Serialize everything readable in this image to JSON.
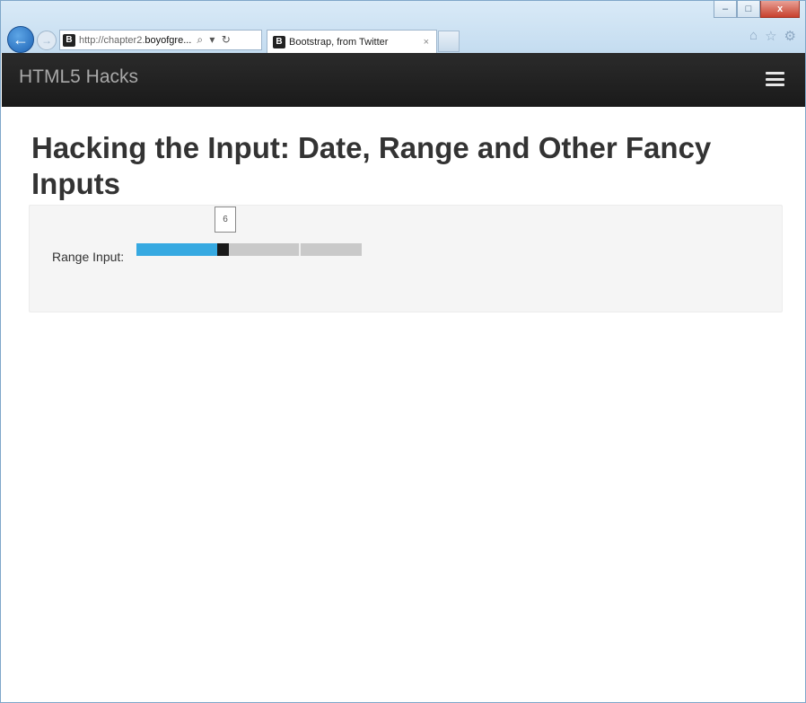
{
  "browser": {
    "address_prefix": "http://chapter2.",
    "address_host": "boyofgre...",
    "address_controls": "⌕ ▾ ↻",
    "favicon_letter": "B",
    "tab_title": "Bootstrap, from Twitter",
    "tab_close": "×",
    "window_controls": {
      "minimize": "–",
      "maximize": "□",
      "close": "x"
    },
    "icons": [
      "home-icon",
      "star-icon",
      "gear-icon"
    ]
  },
  "navbar": {
    "brand": "HTML5 Hacks",
    "menu_icon": "hamburger-menu-icon"
  },
  "page": {
    "title": "Hacking the Input: Date, Range and Other Fancy Inputs"
  },
  "form": {
    "range_label": "Range Input:",
    "range_value": "6",
    "range_min": 0,
    "range_max": 16,
    "range_current": 6,
    "colors": {
      "fill": "#36a9e1",
      "track": "#c9c9c9",
      "thumb": "#1a1a1a"
    }
  }
}
